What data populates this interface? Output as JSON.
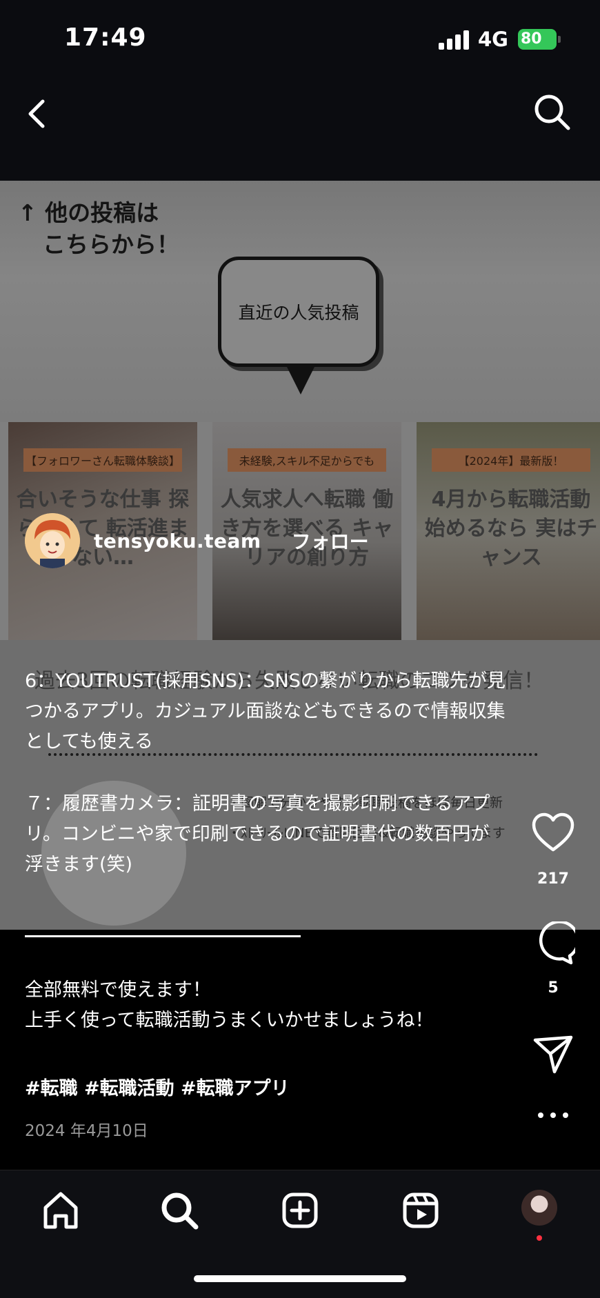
{
  "status": {
    "time": "17:49",
    "network": "4G",
    "battery": "80"
  },
  "post_image": {
    "other_posts_line1": "↑ 他の投稿は",
    "other_posts_line2": "こちらから！",
    "bubble": "直近の人気投稿",
    "cards": [
      {
        "tag": "【フォロワーさん転職体験談】",
        "headline": "合いそうな仕事 探らなくて 転活進まない…"
      },
      {
        "tag": "未経験,スキル不足からでも",
        "headline": "人気求人へ転職 働き方を選べる キャリアの創り方"
      },
      {
        "tag": "【2024年】最新版！",
        "headline": "4月から転職活動 始めるなら 実はチャンス"
      }
    ],
    "ghost_line": "過去3回の転職経験から失敗しない転職のコツを発信！",
    "ghost_bullets": [
      "・図解で分かりやすい転職投稿をほぼ毎日更新",
      "・ｽﾄｰﾘｰ&LINEで質問回答&転職相談やってます"
    ]
  },
  "author": {
    "username": "tensyoku.team",
    "follow_label": "フォロー"
  },
  "caption": {
    "item6": "6：YOUTRUST(採用SNS)：SNSの繋がりから転職先が見つかるアプリ。カジュアル面談などもできるので情報収集としても使える",
    "item7": "７：履歴書カメラ：証明書の写真を撮影印刷できるアプリ。コンビニや家で印刷できるので証明書代の数百円が浮きます(笑)",
    "closing_line1": "全部無料で使えます！",
    "closing_line2": "上手く使って転職活動うまくいかせましょうね！",
    "hashtags": "#転職 #転職活動 #転職アプリ",
    "date": "2024 年4月10日"
  },
  "actions": {
    "likes": "217",
    "comments": "5"
  },
  "colors": {
    "battery": "#34c759",
    "notif_dot": "#ff3040",
    "background": "#000000"
  },
  "icons": [
    "back-icon",
    "search-icon",
    "heart-icon",
    "comment-icon",
    "send-icon",
    "more-icon",
    "home-icon",
    "create-icon",
    "reels-icon"
  ]
}
